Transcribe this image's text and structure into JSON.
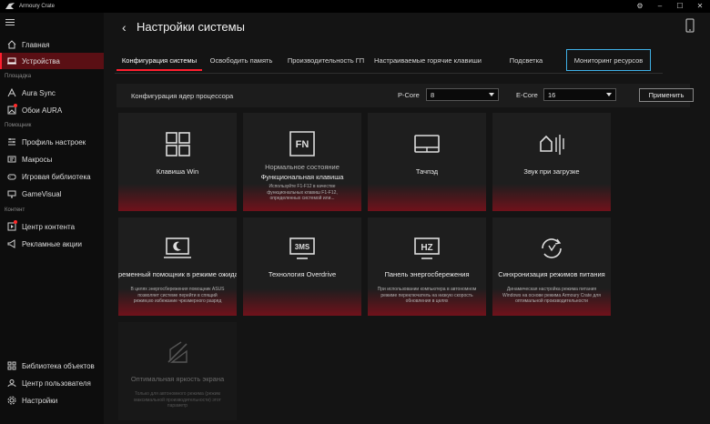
{
  "window": {
    "app_title": "Armoury Crate",
    "controls": [
      "⚙",
      "–",
      "☐",
      "✕"
    ]
  },
  "sidebar": {
    "sections": {
      "area": "Площадка",
      "help": "Помощник",
      "content": "Контент"
    },
    "items": [
      {
        "label": "Главная",
        "icon": "home-icon"
      },
      {
        "label": "Устройства",
        "icon": "devices-icon"
      },
      {
        "label": "Aura Sync",
        "icon": "aura-sync-icon"
      },
      {
        "label": "Обои AURA",
        "icon": "wallpaper-icon"
      },
      {
        "label": "Профиль настроек",
        "icon": "profile-icon"
      },
      {
        "label": "Макросы",
        "icon": "macros-icon"
      },
      {
        "label": "Игровая библиотека",
        "icon": "game-library-icon"
      },
      {
        "label": "GameVisual",
        "icon": "gamevisual-icon"
      },
      {
        "label": "Центр контента",
        "icon": "content-center-icon"
      },
      {
        "label": "Рекламные акции",
        "icon": "promo-icon"
      }
    ],
    "bottom_items": [
      {
        "label": "Библиотека объектов",
        "icon": "object-library-icon"
      },
      {
        "label": "Центр пользователя",
        "icon": "user-center-icon"
      },
      {
        "label": "Настройки",
        "icon": "settings-icon"
      }
    ]
  },
  "main": {
    "title": "Настройки системы",
    "tabs": [
      {
        "label": "Конфигурация системы",
        "active": true
      },
      {
        "label": "Освободить память"
      },
      {
        "label": "Производительность ГП"
      },
      {
        "label": "Настраиваемые горячие клавиши"
      },
      {
        "label": "Подсветка"
      },
      {
        "label": "Мониторинг ресурсов",
        "boxed": true
      }
    ],
    "cpu": {
      "label": "Конфигурация ядер процессора",
      "pcore_label": "P-Core",
      "pcore_value": "8",
      "ecore_label": "E-Core",
      "ecore_value": "16",
      "apply": "Применить"
    },
    "cards": [
      {
        "title": "Клавиша Win",
        "icon": "win-key-icon"
      },
      {
        "subtitle": "Нормальное состояние",
        "title": "Функциональная клавиша",
        "desc": "Используйте F1-F12 в качестве функциональных клавиш F1-F12, определенных системой или...",
        "icon": "fn-key-icon"
      },
      {
        "title": "Тачпэд",
        "icon": "touchpad-icon"
      },
      {
        "title": "Звук при загрузке",
        "icon": "boot-sound-icon"
      },
      {
        "title": "ременный помощник в режиме ожида",
        "desc": "В целях энергосбережения помощник ASUS позволяет системе перейти в спящий режим,во избежание чрезмерного разряд",
        "icon": "standby-assistant-icon"
      },
      {
        "title": "Технология Overdrive",
        "icon": "overdrive-icon"
      },
      {
        "title": "Панель энергосбережения",
        "desc": "При использовании компьютера в автономном режиме переключатель на низкую скорость обновления в целях",
        "icon": "panel-power-saver-icon"
      },
      {
        "title": "Синхронизация режимов питания",
        "desc": "Динамическая настройка режима питания Windows на основе режима Armoury Crate для оптимальной производительности",
        "icon": "power-sync-icon"
      },
      {
        "title": "Оптимальная яркость экрана",
        "desc": "Только для автономного режима (режим максимальной производительности) этот параметр",
        "icon": "optimal-brightness-icon",
        "disabled": true
      }
    ]
  },
  "colors": {
    "accent": "#ff1f2f",
    "active_bg": "#5a0f14",
    "monitor_tab_border": "#3fb0e6",
    "card_bg": "#1e1e1e"
  }
}
